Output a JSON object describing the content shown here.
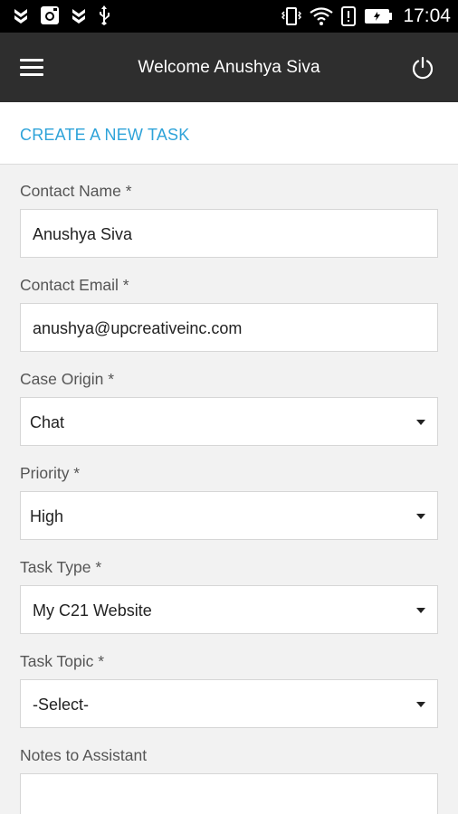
{
  "status_bar": {
    "time": "17:04",
    "icons": [
      "notification-icon",
      "instagram-icon",
      "notification-icon",
      "usb-icon",
      "vibrate-icon",
      "wifi-icon",
      "alert-icon",
      "battery-icon"
    ]
  },
  "app_bar": {
    "title": "Welcome Anushya Siva",
    "menu_icon": "hamburger-menu-icon",
    "power_icon": "power-icon"
  },
  "section": {
    "title": "CREATE A NEW TASK"
  },
  "form": {
    "contact_name": {
      "label": "Contact Name *",
      "value": "Anushya Siva"
    },
    "contact_email": {
      "label": "Contact Email *",
      "value": "anushya@upcreativeinc.com"
    },
    "case_origin": {
      "label": "Case Origin *",
      "value": "Chat"
    },
    "priority": {
      "label": "Priority *",
      "value": "High"
    },
    "task_type": {
      "label": "Task Type *",
      "value": "My C21 Website"
    },
    "task_topic": {
      "label": "Task Topic *",
      "value": "-Select-"
    },
    "notes": {
      "label": "Notes to Assistant",
      "value": ""
    }
  },
  "colors": {
    "accent": "#2ea3d9",
    "app_bar": "#2e2e2e",
    "status_bar": "#000000",
    "background": "#f2f2f2"
  }
}
